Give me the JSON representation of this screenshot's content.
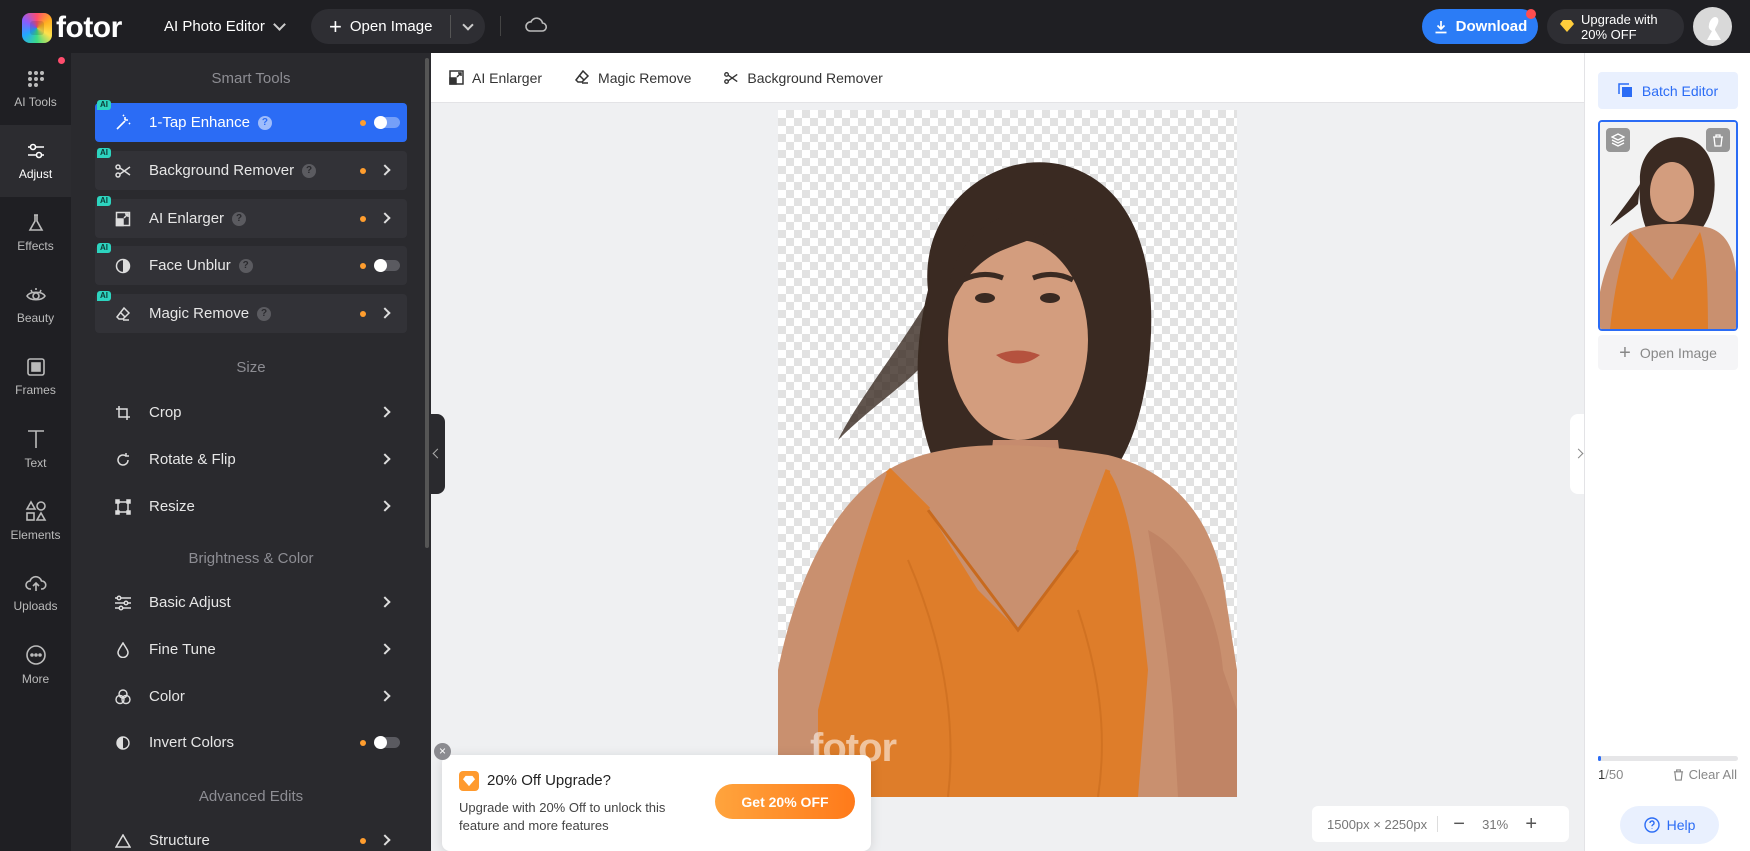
{
  "topbar": {
    "logo": "fotor",
    "app_switch": "AI Photo Editor",
    "open_image": "Open Image",
    "download": "Download",
    "upgrade_line1": "Upgrade with",
    "upgrade_line2": "20% OFF"
  },
  "rail": {
    "items": [
      {
        "label": "AI Tools",
        "icon": "grid-dots-icon"
      },
      {
        "label": "Adjust",
        "icon": "sliders-icon"
      },
      {
        "label": "Effects",
        "icon": "flask-icon"
      },
      {
        "label": "Beauty",
        "icon": "eye-icon"
      },
      {
        "label": "Frames",
        "icon": "frame-icon"
      },
      {
        "label": "Text",
        "icon": "text-icon"
      },
      {
        "label": "Elements",
        "icon": "shapes-icon"
      },
      {
        "label": "Uploads",
        "icon": "cloud-upload-icon"
      },
      {
        "label": "More",
        "icon": "more-circle-icon"
      }
    ],
    "active": "Adjust"
  },
  "panel": {
    "smart_tools_title": "Smart Tools",
    "smart_tools": [
      {
        "label": "1-Tap Enhance",
        "badge": "AI",
        "control": "toggle"
      },
      {
        "label": "Background Remover",
        "badge": "AI",
        "control": "arrow"
      },
      {
        "label": "AI Enlarger",
        "badge": "AI",
        "control": "arrow"
      },
      {
        "label": "Face Unblur",
        "badge": "AI",
        "control": "toggle"
      },
      {
        "label": "Magic Remove",
        "badge": "AI",
        "control": "arrow"
      }
    ],
    "size_title": "Size",
    "size_tools": [
      {
        "label": "Crop"
      },
      {
        "label": "Rotate & Flip"
      },
      {
        "label": "Resize"
      }
    ],
    "brightness_title": "Brightness & Color",
    "brightness_tools": [
      {
        "label": "Basic Adjust"
      },
      {
        "label": "Fine Tune"
      },
      {
        "label": "Color"
      },
      {
        "label": "Invert Colors"
      }
    ],
    "advanced_title": "Advanced Edits",
    "advanced_tools": [
      {
        "label": "Structure"
      }
    ]
  },
  "canvas_toolbar": {
    "ai_enlarger": "AI Enlarger",
    "magic_remove": "Magic Remove",
    "background_remover": "Background Remover"
  },
  "canvas": {
    "watermark": "fotor"
  },
  "promo": {
    "title": "20% Off Upgrade?",
    "text": "Upgrade with 20% Off to unlock this feature and more features",
    "button": "Get 20% OFF",
    "close": "×"
  },
  "zoom": {
    "dimensions": "1500px × 2250px",
    "minus": "−",
    "level": "31%",
    "plus": "+"
  },
  "right_panel": {
    "batch_editor": "Batch Editor",
    "open_image": "Open Image",
    "count_current": "1",
    "count_total": "/50",
    "progress_fraction": 0.02,
    "clear_all": "Clear All",
    "help": "Help"
  },
  "colors": {
    "accent": "#2b6cf5",
    "dark_bg": "#1f1f23",
    "panel_bg": "#2a2a2e",
    "orange": "#ff9d2e"
  }
}
